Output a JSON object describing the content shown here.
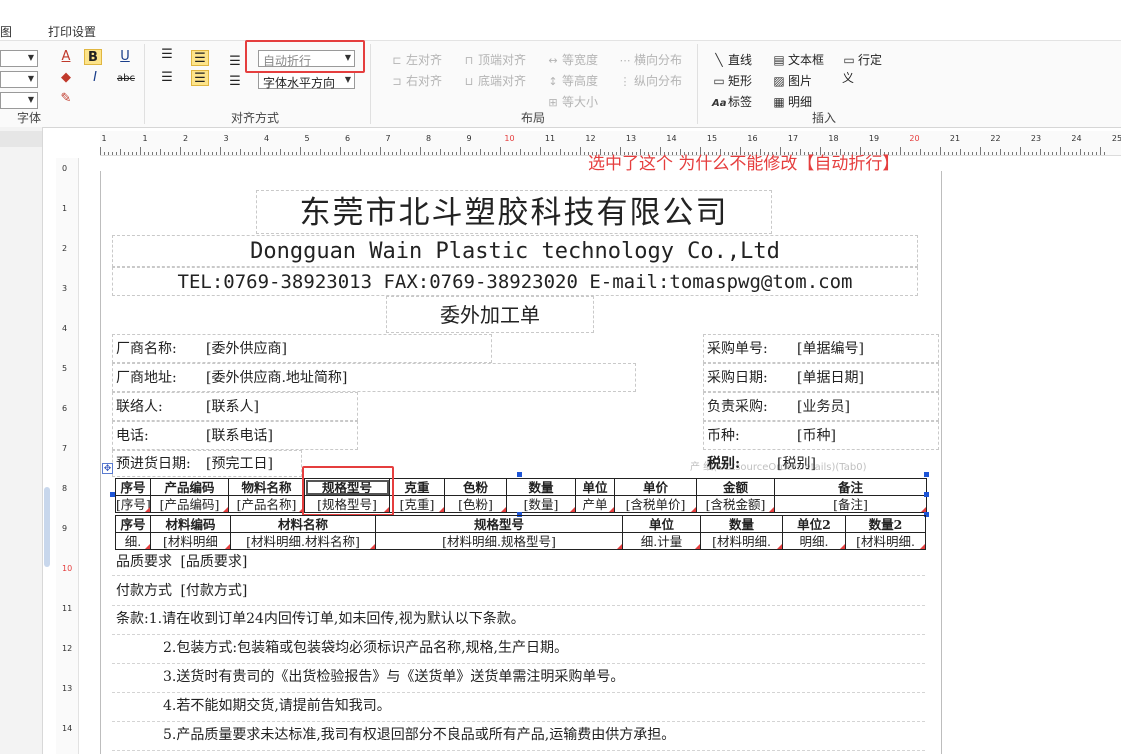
{
  "tabs": {
    "view": "图",
    "print_settings": "打印设置"
  },
  "ribbon": {
    "font_group": {
      "label": "字体",
      "buttons": {
        "font_color": "A",
        "bold": "B",
        "underline": "U",
        "italic": "I",
        "strike": "abc",
        "fill": "◆",
        "pen": "✎"
      }
    },
    "align_group": {
      "label": "对齐方式",
      "wrap_combo": "自动折行",
      "halign_combo": "字体水平方向"
    },
    "layout_group": {
      "label": "布局",
      "items": [
        "左对齐",
        "右对齐",
        "顶端对齐",
        "底端对齐",
        "等宽度",
        "等高度",
        "等大小",
        "横向分布",
        "纵向分布"
      ]
    },
    "insert_group": {
      "label": "插入",
      "items": [
        "直线",
        "矩形",
        "标签",
        "文本框",
        "图片",
        "明细",
        "行定义"
      ]
    }
  },
  "annotation": "选中了这个 为什么不能修改【自动折行】",
  "ruler": {
    "h_numbers": [
      "1",
      "1",
      "2",
      "3",
      "4",
      "5",
      "6",
      "7",
      "8",
      "9",
      "10",
      "11",
      "12",
      "13",
      "14",
      "15",
      "16",
      "17",
      "18",
      "19",
      "20",
      "21",
      "22",
      "23",
      "24",
      "25"
    ],
    "v_numbers": [
      "0",
      "1",
      "2",
      "3",
      "4",
      "5",
      "6",
      "7",
      "8",
      "9",
      "10",
      "11",
      "12",
      "13",
      "14"
    ]
  },
  "report": {
    "company_cn": "东莞市北斗塑胶科技有限公司",
    "company_en": "Dongguan Wain Plastic technology Co.,Ltd",
    "contact": "TEL:0769-38923013   FAX:0769-38923020   E-mail:tomaspwg@tom.com",
    "doc_title": "委外加工单",
    "fields": {
      "vendor_label": "厂商名称:",
      "vendor_value": "[委外供应商]",
      "address_label": "厂商地址:",
      "address_value": "[委外供应商.地址简称]",
      "contact_label": "联络人:",
      "contact_value": "[联系人]",
      "phone_label": "电话:",
      "phone_value": "[联系电话]",
      "eta_label": "预进货日期:",
      "eta_value": "[预完工日]",
      "po_label": "采购单号:",
      "po_value": "[单据编号]",
      "po_date_label": "采购日期:",
      "po_date_value": "[单据日期]",
      "buyer_label": "负责采购:",
      "buyer_value": "[业务员]",
      "currency_label": "币种:",
      "currency_value": "[币种]",
      "tax_label": "税别:",
      "tax_value": "[税别]"
    },
    "ghost_text": "产 细(OutsourceOrderDetails)(Tab0)",
    "detail_table": {
      "headers": [
        "序号",
        "产品编码",
        "物料名称",
        "规格型号",
        "克重",
        "色粉",
        "数量",
        "单位",
        "单价",
        "金额",
        "备注"
      ],
      "values": [
        "[序号]",
        "[产品编码]",
        "[产品名称]",
        "[规格型号]",
        "[克重]",
        "[色粉]",
        "[数量]",
        "产单",
        "[含税单价]",
        "[含税金额]",
        "[备注]"
      ]
    },
    "material_table": {
      "headers": [
        "序号",
        "材料编码",
        "材料名称",
        "规格型号",
        "单位",
        "数量",
        "单位2",
        "数量2"
      ],
      "values": [
        "细.",
        "[材料明细",
        "[材料明细.材料名称]",
        "[材料明细.规格型号]",
        "细.计量",
        "[材料明细.",
        "明细.",
        "[材料明细."
      ]
    },
    "quality_label": "品质要求",
    "quality_value": "[品质要求]",
    "payment_label": "付款方式",
    "payment_value": "[付款方式]",
    "terms": [
      "条款:1.请在收到订单24内回传订单,如未回传,视为默认以下条款。",
      "2.包装方式:包装箱或包装袋均必须标识产品名称,规格,生产日期。",
      "3.送货时有贵司的《出货检验报告》与《送货单》送货单需注明采购单号。",
      "4.若不能如期交货,请提前告知我司。",
      "5.产品质量要求未达标准,我司有权退回部分不良品或所有产品,运输费由供方承担。"
    ]
  }
}
